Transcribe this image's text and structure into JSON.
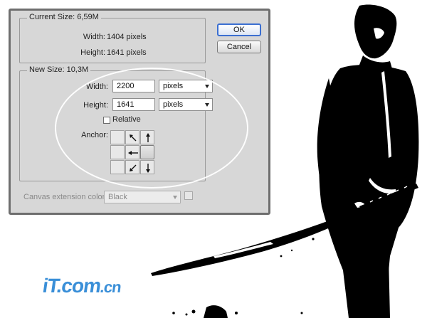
{
  "dialog": {
    "current_size": {
      "title": "Current Size: 6,59M",
      "width_label": "Width:",
      "width_value": "1404 pixels",
      "height_label": "Height:",
      "height_value": "1641 pixels"
    },
    "new_size": {
      "title": "New Size: 10,3M",
      "width_label": "Width:",
      "width_value": "2200",
      "width_unit": "pixels",
      "height_label": "Height:",
      "height_value": "1641",
      "height_unit": "pixels",
      "relative_label": "Relative",
      "relative_checked": false,
      "anchor_label": "Anchor:"
    },
    "extension_color": {
      "label": "Canvas extension color:",
      "value": "Black",
      "enabled": false
    },
    "buttons": {
      "ok": "OK",
      "cancel": "Cancel"
    }
  },
  "watermark": {
    "text_main": "iT.com",
    "text_suffix": ".cn"
  },
  "colors": {
    "dialog_bg": "#d7d7d7",
    "accent": "#3b6fd1",
    "logo": "#3a8fd8"
  }
}
